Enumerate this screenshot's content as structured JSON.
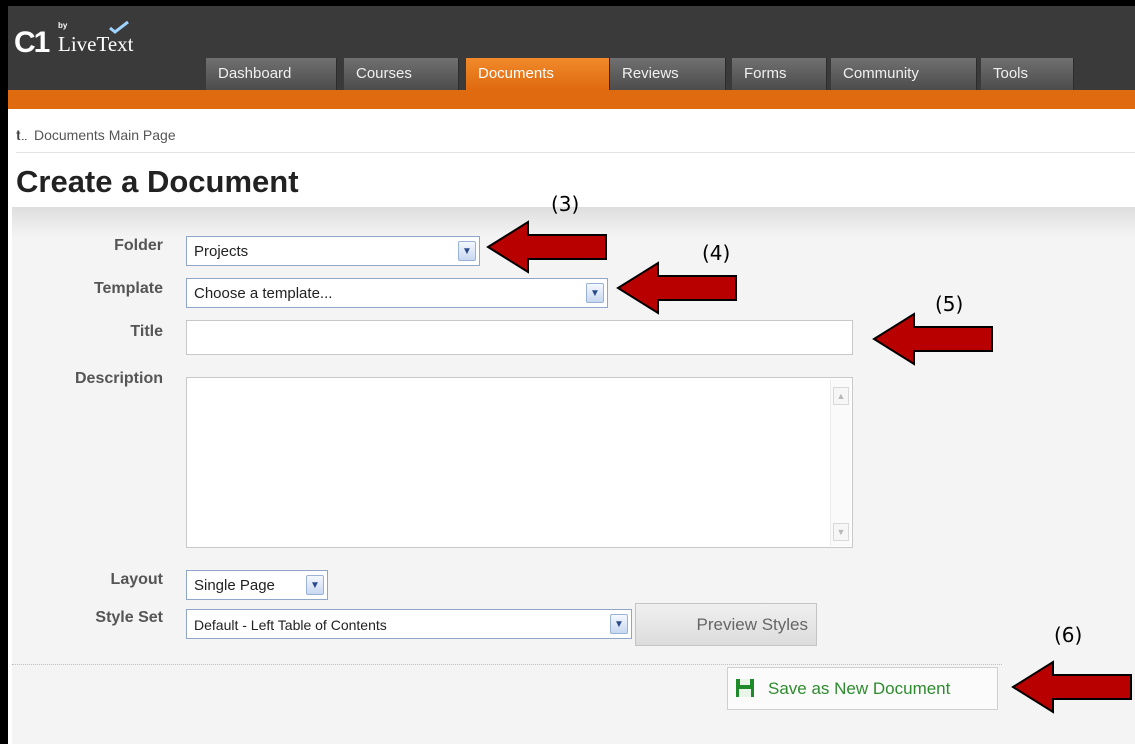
{
  "logo": {
    "mark": "C1",
    "by": "by",
    "brand": "LiveText"
  },
  "nav": {
    "tabs": [
      {
        "label": "Dashboard",
        "active": false
      },
      {
        "label": "Courses",
        "active": false
      },
      {
        "label": "Documents",
        "active": true
      },
      {
        "label": "Reviews",
        "active": false
      },
      {
        "label": "Forms",
        "active": false
      },
      {
        "label": "Community",
        "active": false
      },
      {
        "label": "Tools",
        "active": false
      }
    ]
  },
  "breadcrumb": {
    "icon": "back-arrow-icon",
    "label": "Documents Main Page"
  },
  "page": {
    "title": "Create a Document"
  },
  "form": {
    "folder": {
      "label": "Folder",
      "value": "Projects"
    },
    "template": {
      "label": "Template",
      "value": "Choose a template..."
    },
    "title": {
      "label": "Title",
      "value": ""
    },
    "description": {
      "label": "Description",
      "value": ""
    },
    "layout": {
      "label": "Layout",
      "value": "Single Page"
    },
    "style_set": {
      "label": "Style Set",
      "value": "Default - Left Table of Contents"
    },
    "preview_label": "Preview Styles",
    "save_label": "Save as New Document"
  },
  "annotations": {
    "a3": "(3)",
    "a4": "(4)",
    "a5": "(5)",
    "a6": "(6)"
  },
  "colors": {
    "accent": "#e06a10",
    "header": "#3a3a3a",
    "arrow": "#b80000",
    "save_text": "#2e8b2e"
  }
}
